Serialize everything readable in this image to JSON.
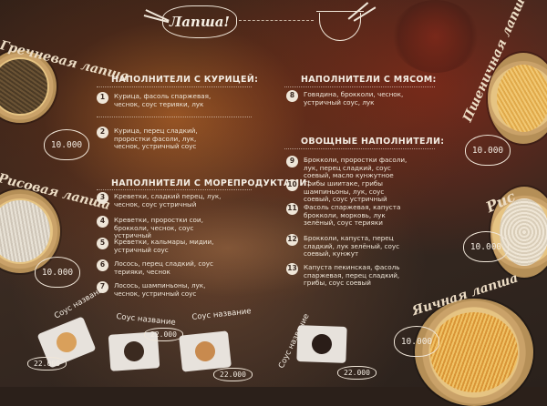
{
  "header": {
    "logo_text": "Лапша!"
  },
  "noodles": [
    {
      "label": "Гречневая лапша",
      "price": "10.000"
    },
    {
      "label": "Рисовая лапша",
      "price": "10.000"
    },
    {
      "label": "Пшеничная лапша",
      "price": "10.000"
    },
    {
      "label": "Рис",
      "price": "10.000"
    },
    {
      "label": "Яичная лапша",
      "price": "10.000"
    }
  ],
  "sections": {
    "chicken": "НАПОЛНИТЕЛИ С КУРИЦЕЙ:",
    "meat": "НАПОЛНИТЕЛИ С МЯСОМ:",
    "vegetable": "ОВОЩНЫЕ НАПОЛНИТЕЛИ:",
    "seafood": "НАПОЛНИТЕЛИ С МОРЕПРОДУКТАМИ:"
  },
  "fillings": [
    {
      "num": "1",
      "text": "Курица, фасоль спаржевая, чеснок, соус терияки, лук"
    },
    {
      "num": "2",
      "text": "Курица, перец сладкий, проростки фасоли, лук, чеснок, устричный соус"
    },
    {
      "num": "3",
      "text": "Креветки, сладкий перец, лук, чеснок, соус устричный"
    },
    {
      "num": "4",
      "text": "Креветки, проростки сои, брокколи, чеснок, соус устричный"
    },
    {
      "num": "5",
      "text": "Креветки, кальмары, мидии, устричный соус"
    },
    {
      "num": "6",
      "text": "Лосось, перец сладкий, соус терияки, чеснок"
    },
    {
      "num": "7",
      "text": "Лосось, шампиньоны, лук, чеснок, устричный соус"
    },
    {
      "num": "8",
      "text": "Говядина, брокколи, чеснок, устричный соус, лук"
    },
    {
      "num": "9",
      "text": "Брокколи, проростки фасоли, лук, перец сладкий, соус соевый, масло кунжутное"
    },
    {
      "num": "10",
      "text": "Грибы шиитаке, грибы шампиньоны, лук, соус соевый, соус устричный"
    },
    {
      "num": "11",
      "text": "Фасоль спаржевая, капуста брокколи, морковь, лук зелёный, соус терияки"
    },
    {
      "num": "12",
      "text": "Брокколи, капуста, перец сладкий, лук зелёный, соус соевый, кунжут"
    },
    {
      "num": "13",
      "text": "Капуста пекинская, фасоль спаржевая, перец сладкий, грибы, соус соевый"
    }
  ],
  "sauces": [
    {
      "label": "Соус название",
      "price": "22.000",
      "dot": "#d9a05b"
    },
    {
      "label": "Соус название",
      "price": "22.000",
      "dot": "#3b2a20"
    },
    {
      "label": "Соус название",
      "price": "22.000",
      "dot": "#c88a4e"
    },
    {
      "label": "Соус название",
      "price": "22.000",
      "dot": "#2a1d18"
    }
  ]
}
